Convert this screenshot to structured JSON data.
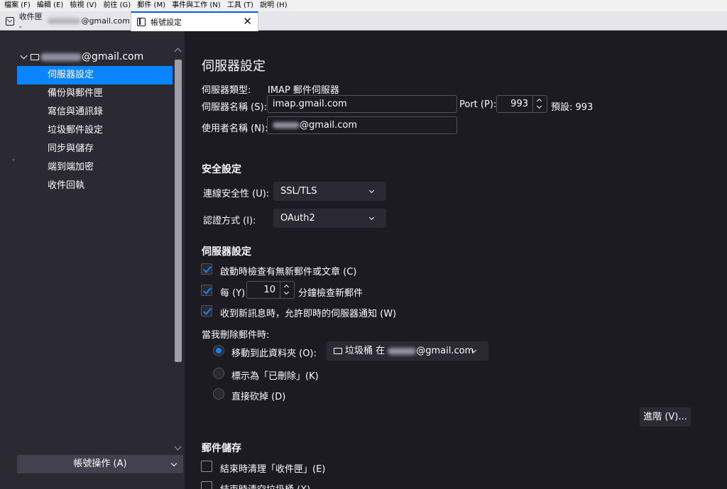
{
  "menubar": {
    "items": [
      "檔案 (F)",
      "編輯 (E)",
      "檢視 (V)",
      "前往 (G)",
      "郵件 (M)",
      "事件與工作 (N)",
      "工具 (T)",
      "說明 (H)"
    ]
  },
  "tabs": {
    "inbox_prefix": "收件匣 - ",
    "inbox_suffix": "@gmail.com",
    "settings_label": "帳號設定",
    "close_glyph": "✕"
  },
  "sidebar": {
    "account_suffix": "@gmail.com",
    "items": [
      {
        "label": "伺服器設定",
        "active": true
      },
      {
        "label": "備份與郵件匣",
        "active": false
      },
      {
        "label": "寫信與通訊錄",
        "active": false
      },
      {
        "label": "垃圾郵件設定",
        "active": false
      },
      {
        "label": "同步與儲存",
        "active": false
      },
      {
        "label": "端到端加密",
        "active": false
      },
      {
        "label": "收件回執",
        "active": false
      }
    ],
    "stray_mark": "▾",
    "account_actions": "帳號操作 (A)"
  },
  "main": {
    "title": "伺服器設定",
    "server_type_label": "伺服器類型:",
    "server_type_value": "IMAP 郵件伺服器",
    "server_name_label": "伺服器名稱 (S):",
    "server_name_value": "imap.gmail.com",
    "port_label": "Port (P):",
    "port_value": "993",
    "port_default": "預設: 993",
    "username_label": "使用者名稱 (N):",
    "username_suffix": "@gmail.com",
    "security": {
      "heading": "安全設定",
      "connection_label": "連線安全性 (U):",
      "connection_value": "SSL/TLS",
      "auth_label": "認證方式 (I):",
      "auth_value": "OAuth2"
    },
    "server_settings": {
      "heading": "伺服器設定",
      "check_on_startup": "啟動時檢查有無新郵件或文章 (C)",
      "check_every_prefix": "每 (Y)",
      "check_every_value": "10",
      "check_every_suffix": "分鐘檢查新郵件",
      "push_notify": "收到新訊息時，允許即時的伺服器通知 (W)",
      "on_delete_label": "當我刪除郵件時:",
      "move_to_folder": "移動到此資料夾 (O):",
      "folder_prefix": "垃圾桶 在 ",
      "folder_suffix": "@gmail.com",
      "mark_deleted": "標示為「已刪除」(K)",
      "delete_now": "直接砍掉 (D)",
      "advanced": "進階 (V)..."
    },
    "storage": {
      "heading": "郵件儲存",
      "clean_inbox": "結束時清理「收件匣」(E)",
      "empty_trash": "結束時清空垃圾桶 (X)"
    }
  }
}
